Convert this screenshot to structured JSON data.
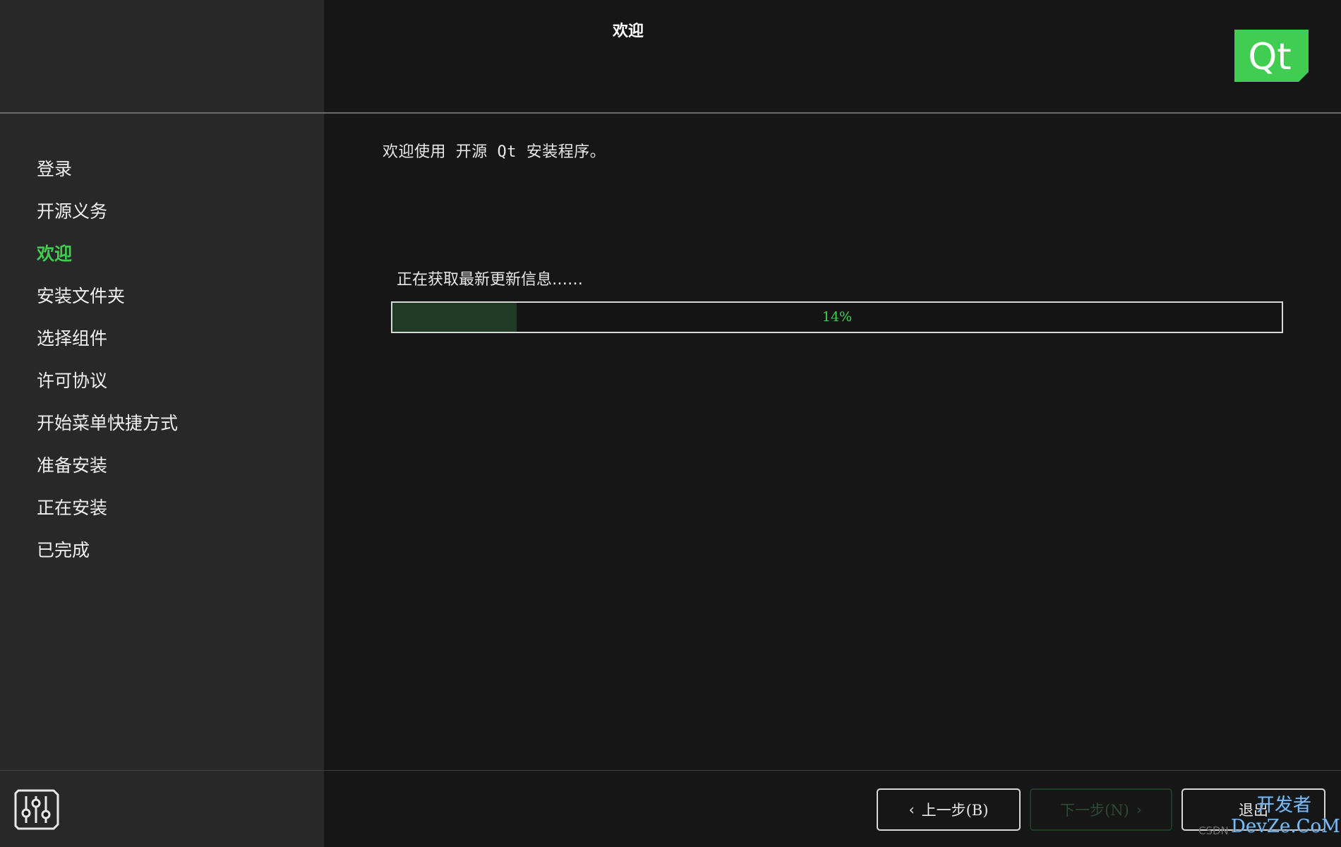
{
  "window": {
    "title": "欢迎"
  },
  "sidebar": {
    "steps": [
      {
        "label": "登录"
      },
      {
        "label": "开源义务"
      },
      {
        "label": "欢迎"
      },
      {
        "label": "安装文件夹"
      },
      {
        "label": "选择组件"
      },
      {
        "label": "许可协议"
      },
      {
        "label": "开始菜单快捷方式"
      },
      {
        "label": "准备安装"
      },
      {
        "label": "正在安装"
      },
      {
        "label": "已完成"
      }
    ],
    "active_index": 2
  },
  "logo": {
    "text": "Qt",
    "color": "#41cd52"
  },
  "main": {
    "welcome_text": "欢迎使用 开源 Qt 安装程序。",
    "status_text": "正在获取最新更新信息……",
    "progress": {
      "value": 14,
      "label": "14%"
    }
  },
  "footer": {
    "settings_icon": "settings-sliders-icon",
    "back_label": "上一步(B)",
    "next_label": "下一步(N)",
    "quit_label": "退出"
  },
  "watermark": {
    "small": "CSDN",
    "big": "开发者",
    "site": "DevZe.CoM"
  },
  "colors": {
    "accent": "#41cd52",
    "progress_fill": "#1f3b26",
    "background": "#161616",
    "sidebar": "#282828"
  }
}
